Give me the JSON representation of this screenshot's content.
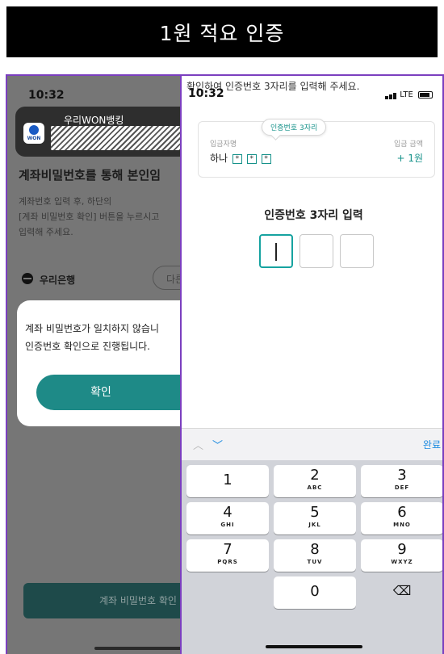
{
  "title": "1원 적요 인증",
  "left_screen": {
    "time": "10:32",
    "notification": {
      "app_name": "우리WON뱅킹",
      "logo_text": "WON"
    },
    "heading": "계좌비밀번호를 통해 본인임",
    "description_lines": [
      "계좌번호 입력 후, 하단의",
      "[계좌 비밀번호 확인] 버튼을 누르시고",
      "입력해 주세요."
    ],
    "bank_name": "우리은행",
    "other_button": "다른",
    "dialog": {
      "message_lines": [
        "계좌 비밀번호가 일치하지 않습니",
        "인증번호 확인으로 진행됩니다."
      ],
      "confirm_label": "확인"
    },
    "bottom_button": "계좌 비밀번호 확인"
  },
  "right_screen": {
    "top_text": "확인하여 인증번호 3자리를 입력해 주세요.",
    "time": "10:32",
    "network": "LTE",
    "card": {
      "tooltip": "인증번호 3자리",
      "sender_label": "입금자명",
      "sender_prefix": "하나",
      "masked_chars": [
        "*",
        "*",
        "*"
      ],
      "amount_label": "입금 금액",
      "amount": "+ 1원"
    },
    "code_title": "인증번호 3자리 입력",
    "keyboard": {
      "up": "︿",
      "down": "﹀",
      "done": "완료",
      "keys": [
        {
          "digit": "1",
          "letters": ""
        },
        {
          "digit": "2",
          "letters": "ABC"
        },
        {
          "digit": "3",
          "letters": "DEF"
        },
        {
          "digit": "4",
          "letters": "GHI"
        },
        {
          "digit": "5",
          "letters": "JKL"
        },
        {
          "digit": "6",
          "letters": "MNO"
        },
        {
          "digit": "7",
          "letters": "PQRS"
        },
        {
          "digit": "8",
          "letters": "TUV"
        },
        {
          "digit": "9",
          "letters": "WXYZ"
        },
        {
          "digit": "0",
          "letters": ""
        }
      ],
      "backspace": "⌫"
    }
  }
}
